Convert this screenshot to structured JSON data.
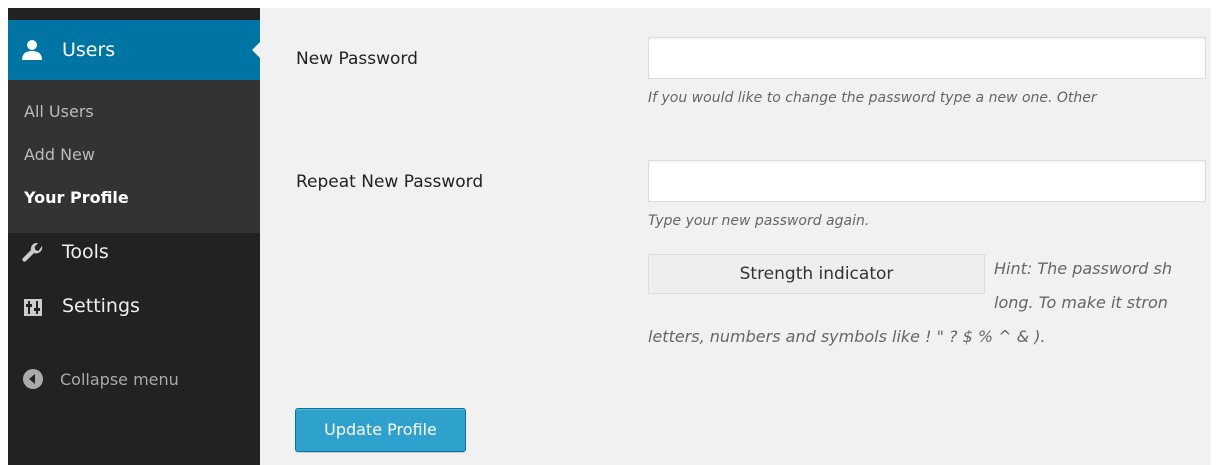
{
  "sidebar": {
    "active_menu": {
      "label": "Users",
      "icon": "user-icon"
    },
    "submenu": [
      {
        "label": "All Users",
        "current": false
      },
      {
        "label": "Add New",
        "current": false
      },
      {
        "label": "Your Profile",
        "current": true
      }
    ],
    "items": [
      {
        "label": "Tools",
        "icon": "wrench-icon"
      },
      {
        "label": "Settings",
        "icon": "sliders-icon"
      }
    ],
    "collapse": {
      "label": "Collapse menu",
      "icon": "collapse-arrow-icon"
    }
  },
  "form": {
    "new_password": {
      "label": "New Password",
      "value": "",
      "description": "If you would like to change the password type a new one. Other"
    },
    "repeat_password": {
      "label": "Repeat New Password",
      "value": "",
      "description": "Type your new password again."
    },
    "strength_indicator": "Strength indicator",
    "hint": {
      "line1": "Hint: The password sh",
      "line2": "long. To make it stron",
      "line3": "letters, numbers and symbols like ! \" ? $ % ^ & )."
    },
    "submit_label": "Update Profile"
  },
  "colors": {
    "sidebar_bg": "#222222",
    "submenu_bg": "#333333",
    "active_menu_bg": "#0074a2",
    "content_bg": "#f1f1f1",
    "button_bg": "#2ea2cc"
  }
}
